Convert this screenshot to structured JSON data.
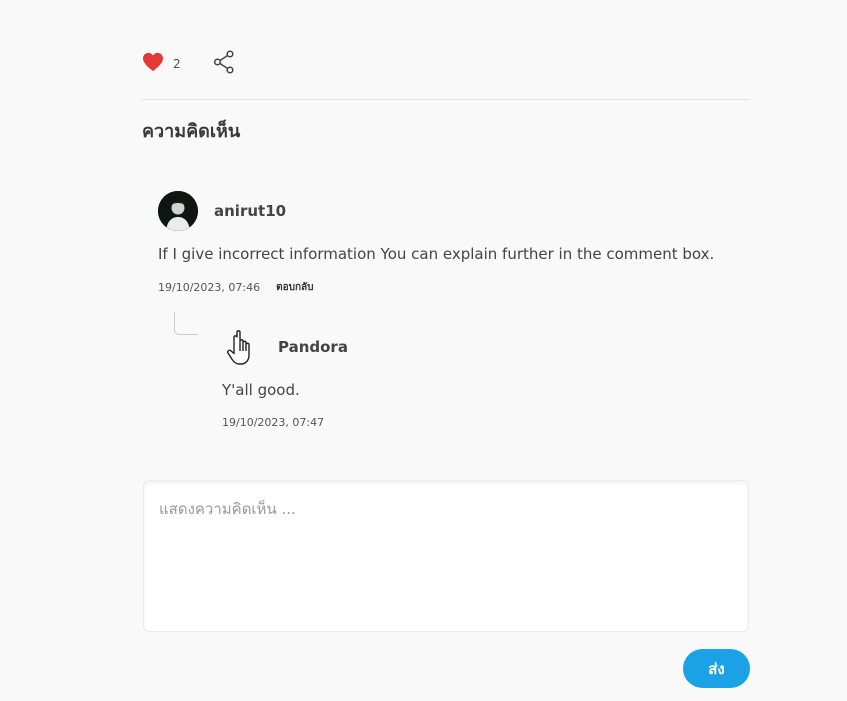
{
  "actions": {
    "like_count": "2",
    "like_color": "#e53935",
    "like_icon": "heart-icon",
    "share_icon": "share-icon"
  },
  "comments_section": {
    "title": "ความคิดเห็น"
  },
  "comment": {
    "author": "anirut10",
    "text": "If I give incorrect information You can explain further in the comment box.",
    "timestamp": "19/10/2023, 07:46",
    "reply_label": "ตอบกลับ"
  },
  "reply": {
    "author": "Pandora",
    "text": "Y'all good.",
    "timestamp": "19/10/2023, 07:47"
  },
  "composer": {
    "placeholder": "แสดงความคิดเห็น ...",
    "value": "",
    "send_label": "ส่ง",
    "send_color": "#1ba2e6"
  }
}
